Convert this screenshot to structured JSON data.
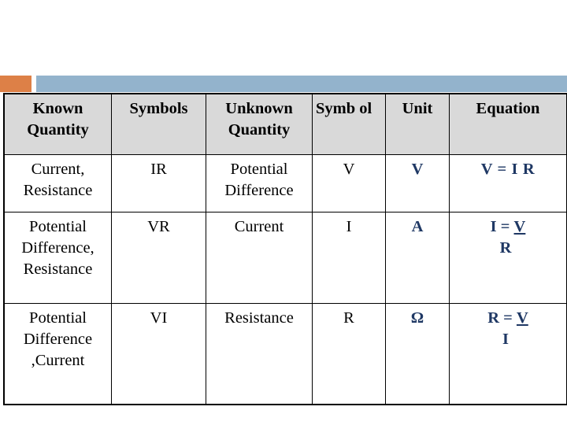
{
  "slide": {
    "background_color": "#FFFFFF",
    "decor": {
      "orange_color": "#DD8047",
      "blue_color": "#93B3CC",
      "orange_name": "orange-accent-block",
      "blue_name": "blue-accent-bar"
    }
  },
  "table": {
    "header_background": "#D9D9D9",
    "border_color": "#000000",
    "accent_text_color": "#1F3864",
    "headers": [
      "Known Quantity",
      "Symbols",
      "Unknown Quantity",
      "Symb ol",
      "Unit",
      "Equation"
    ],
    "rows": [
      {
        "known_quantity": "Current, Resistance",
        "symbols": "IR",
        "unknown_quantity": "Potential Difference",
        "symbol": "V",
        "unit": "V",
        "equation": {
          "type": "inline",
          "text": "V = I R"
        }
      },
      {
        "known_quantity": "Potential Difference, Resistance",
        "symbols": "VR",
        "unknown_quantity": "Current",
        "symbol": "I",
        "unit": "A",
        "equation": {
          "type": "fraction",
          "lhs": "I =",
          "numerator": "V",
          "denominator": "R"
        }
      },
      {
        "known_quantity": "Potential Difference ,Current",
        "symbols": "VI",
        "unknown_quantity": "Resistance",
        "symbol": "R",
        "unit": "Ω",
        "equation": {
          "type": "fraction",
          "lhs": "R =",
          "numerator": "V",
          "denominator": "I"
        }
      }
    ]
  }
}
